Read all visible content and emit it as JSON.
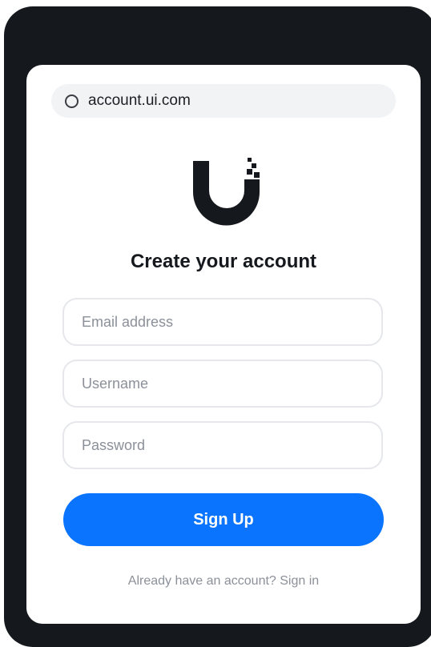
{
  "browser": {
    "url": "account.ui.com"
  },
  "form": {
    "title": "Create your account",
    "email_placeholder": "Email address",
    "username_placeholder": "Username",
    "password_placeholder": "Password",
    "submit_label": "Sign Up",
    "signin_link": "Already have an account? Sign in"
  },
  "colors": {
    "device_frame": "#15181c",
    "primary_button": "#0a74ff",
    "url_bar": "#f2f3f5",
    "field_border": "#e5e7eb"
  },
  "icons": {
    "url_status": "circle-icon",
    "brand_logo": "ui-logo-icon"
  }
}
